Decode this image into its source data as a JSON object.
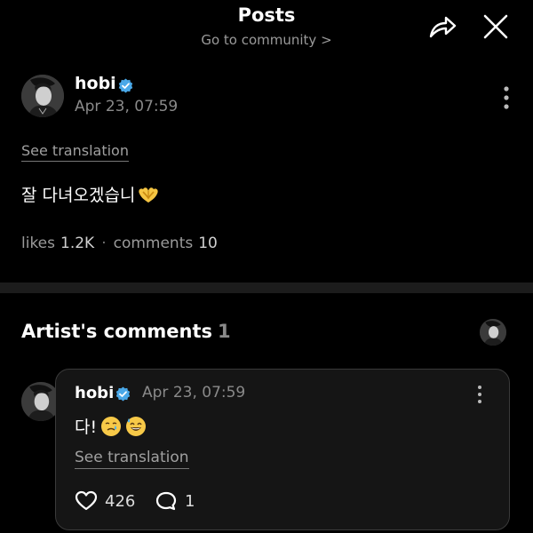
{
  "header": {
    "title": "Posts",
    "subtitle": "Go to community >",
    "share_icon": "share-icon",
    "close_icon": "close-icon"
  },
  "post": {
    "author": "hobi",
    "date": "Apr 23, 07:59",
    "see_translation": "See translation",
    "body": "잘 다녀오겠습니",
    "body_emoji": "heart-hands-emoji",
    "likes_label": "likes",
    "likes_count": "1.2K",
    "separator": "·",
    "comments_label": "comments",
    "comments_count": "10"
  },
  "artist_comments": {
    "title": "Artist's comments",
    "count": "1",
    "comment": {
      "author": "hobi",
      "date": "Apr 23, 07:59",
      "body": "다!",
      "emojis": [
        "crying-smile-emoji",
        "sweat-smile-emoji"
      ],
      "see_translation": "See translation",
      "likes": "426",
      "replies": "1"
    }
  },
  "colors": {
    "background": "#000000",
    "muted_text": "#8a8a8a",
    "verified_badge": "#4aa8e8",
    "card_background": "#151515",
    "card_border": "#3a3a3a",
    "divider": "#1c1c1c"
  }
}
